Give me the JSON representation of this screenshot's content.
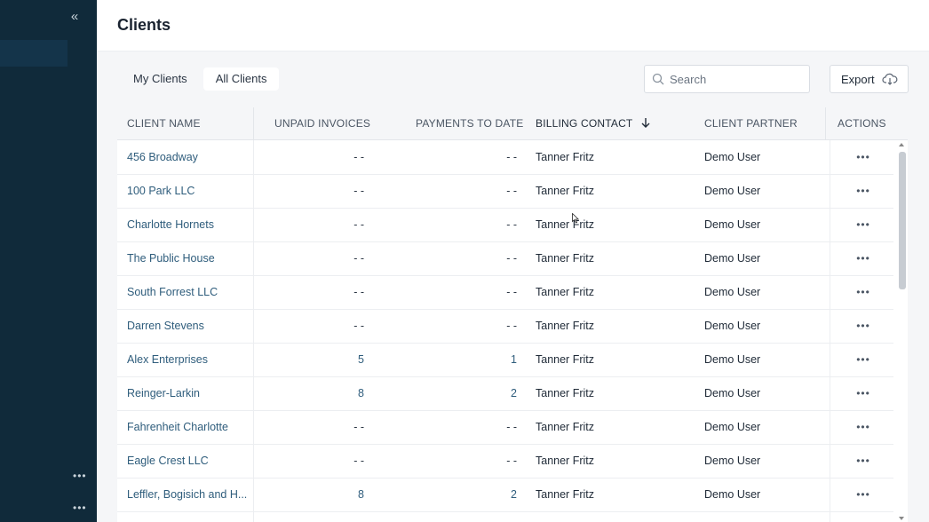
{
  "sidebar": {
    "collapse_glyph": "«",
    "dots_glyph": "•••"
  },
  "header": {
    "title": "Clients"
  },
  "tabs": [
    {
      "label": "My Clients"
    },
    {
      "label": "All Clients"
    }
  ],
  "search": {
    "placeholder": "Search"
  },
  "export": {
    "label": "Export"
  },
  "table": {
    "columns": {
      "client_name": "CLIENT NAME",
      "unpaid_invoices": "UNPAID INVOICES",
      "payments_to_date": "PAYMENTS TO DATE",
      "billing_contact": "BILLING CONTACT",
      "client_partner": "CLIENT PARTNER",
      "actions": "ACTIONS"
    },
    "sort_icon": "arrow-down-icon",
    "rows": [
      {
        "name": "456 Broadway",
        "unpaid": "- -",
        "payments": "- -",
        "contact": "Tanner Fritz",
        "partner": "Demo User",
        "actions": "•••"
      },
      {
        "name": "100 Park LLC",
        "unpaid": "- -",
        "payments": "- -",
        "contact": "Tanner Fritz",
        "partner": "Demo User",
        "actions": "•••"
      },
      {
        "name": "Charlotte Hornets",
        "unpaid": "- -",
        "payments": "- -",
        "contact": "Tanner Fritz",
        "partner": "Demo User",
        "actions": "•••"
      },
      {
        "name": "The Public House",
        "unpaid": "- -",
        "payments": "- -",
        "contact": "Tanner Fritz",
        "partner": "Demo User",
        "actions": "•••"
      },
      {
        "name": "South Forrest LLC",
        "unpaid": "- -",
        "payments": "- -",
        "contact": "Tanner Fritz",
        "partner": "Demo User",
        "actions": "•••"
      },
      {
        "name": "Darren Stevens",
        "unpaid": "- -",
        "payments": "- -",
        "contact": "Tanner Fritz",
        "partner": "Demo User",
        "actions": "•••"
      },
      {
        "name": "Alex Enterprises",
        "unpaid": "5",
        "payments": "1",
        "contact": "Tanner Fritz",
        "partner": "Demo User",
        "actions": "•••"
      },
      {
        "name": "Reinger-Larkin",
        "unpaid": "8",
        "payments": "2",
        "contact": "Tanner Fritz",
        "partner": "Demo User",
        "actions": "•••"
      },
      {
        "name": "Fahrenheit Charlotte",
        "unpaid": "- -",
        "payments": "- -",
        "contact": "Tanner Fritz",
        "partner": "Demo User",
        "actions": "•••"
      },
      {
        "name": "Eagle Crest LLC",
        "unpaid": "- -",
        "payments": "- -",
        "contact": "Tanner Fritz",
        "partner": "Demo User",
        "actions": "•••"
      },
      {
        "name": "Leffler, Bogisich and H...",
        "unpaid": "8",
        "payments": "2",
        "contact": "Tanner Fritz",
        "partner": "Demo User",
        "actions": "•••"
      }
    ]
  },
  "colors": {
    "sidebar_bg": "#102a3a",
    "link": "#2f5d7c",
    "page_bg": "#f5f6f8"
  }
}
